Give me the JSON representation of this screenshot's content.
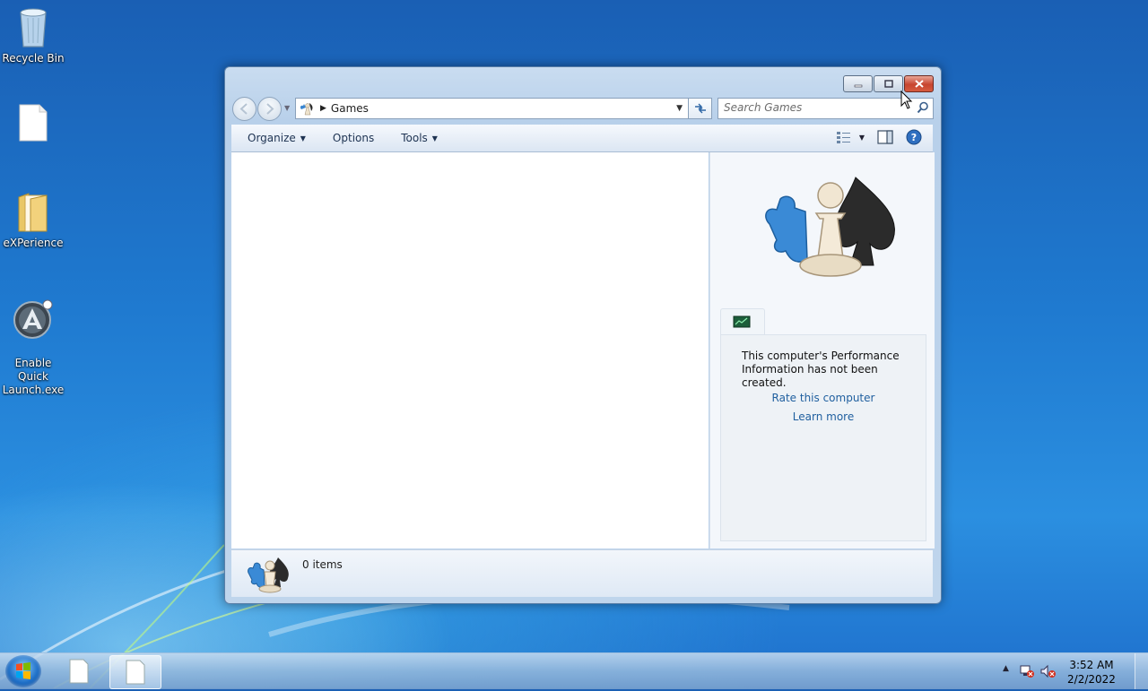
{
  "desktop": {
    "icons": [
      {
        "label": "Recycle Bin"
      },
      {
        "label": ""
      },
      {
        "label": "eXPerience"
      },
      {
        "label": "Enable Quick\nLaunch.exe"
      }
    ]
  },
  "window": {
    "address": {
      "current": "Games"
    },
    "search": {
      "placeholder": "Search Games"
    },
    "toolbar": {
      "organize": "Organize",
      "options": "Options",
      "tools": "Tools"
    },
    "preview": {
      "message": "This computer's Performance Information has not been created.",
      "link_rate": "Rate this computer",
      "link_learn": "Learn more"
    },
    "details": {
      "count": "0 items"
    }
  },
  "taskbar": {
    "clock_time": "3:52 AM",
    "clock_date": "2/2/2022"
  },
  "colors": {
    "link": "#1f5f9f",
    "close": "#c7452f"
  }
}
